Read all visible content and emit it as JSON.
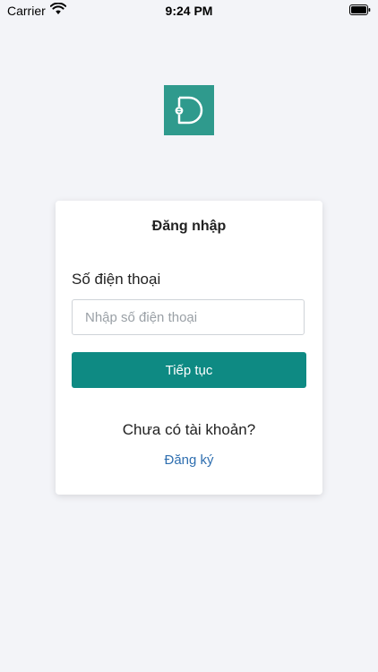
{
  "status_bar": {
    "carrier": "Carrier",
    "time": "9:24 PM"
  },
  "login": {
    "title": "Đăng nhập",
    "phone_label": "Số điện thoại",
    "phone_placeholder": "Nhập số điện thoại",
    "phone_value": "",
    "continue_label": "Tiếp tục",
    "no_account_text": "Chưa có tài khoản?",
    "register_label": "Đăng ký"
  },
  "colors": {
    "brand": "#2f9a8d",
    "button": "#0e8a83",
    "link": "#2f6fb0",
    "background": "#f3f4f8"
  },
  "icons": {
    "status": [
      "wifi-icon",
      "battery-icon"
    ],
    "logo": "app-logo"
  }
}
